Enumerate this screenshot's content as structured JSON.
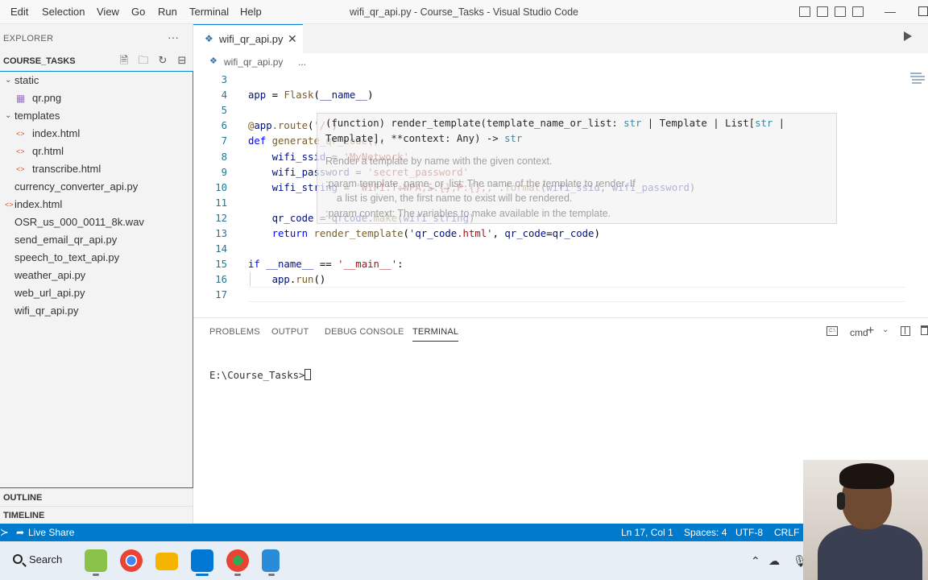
{
  "window": {
    "title": "wifi_qr_api.py - Course_Tasks - Visual Studio Code",
    "menu": [
      "Edit",
      "Selection",
      "View",
      "Go",
      "Run",
      "Terminal",
      "Help"
    ]
  },
  "sidebar": {
    "title": "EXPLORER",
    "more": "···",
    "folder": "COURSE_TASKS",
    "tree": [
      {
        "label": "static",
        "kind": "folder",
        "depth": 0
      },
      {
        "label": "qr.png",
        "kind": "image",
        "depth": 1
      },
      {
        "label": "templates",
        "kind": "folder",
        "depth": 0
      },
      {
        "label": "index.html",
        "kind": "html",
        "depth": 1
      },
      {
        "label": "qr.html",
        "kind": "html",
        "depth": 1
      },
      {
        "label": "transcribe.html",
        "kind": "html",
        "depth": 1
      },
      {
        "label": "currency_converter_api.py",
        "kind": "py",
        "depth": 0
      },
      {
        "label": "index.html",
        "kind": "html",
        "depth": 0
      },
      {
        "label": "OSR_us_000_0011_8k.wav",
        "kind": "wav",
        "depth": 0
      },
      {
        "label": "send_email_qr_api.py",
        "kind": "py",
        "depth": 0
      },
      {
        "label": "speech_to_text_api.py",
        "kind": "py",
        "depth": 0
      },
      {
        "label": "weather_api.py",
        "kind": "py",
        "depth": 0
      },
      {
        "label": "web_url_api.py",
        "kind": "py",
        "depth": 0
      },
      {
        "label": "wifi_qr_api.py",
        "kind": "py",
        "depth": 0
      }
    ],
    "outline": "OUTLINE",
    "timeline": "TIMELINE"
  },
  "editor": {
    "tab": "wifi_qr_api.py",
    "close": "✕",
    "breadcrumb_file": "wifi_qr_api.py",
    "breadcrumb_more": "...",
    "lines": [
      {
        "n": "3",
        "t": ""
      },
      {
        "n": "4",
        "t": "app = Flask(__name__)"
      },
      {
        "n": "5",
        "t": ""
      },
      {
        "n": "6",
        "t": "@app.route('/')"
      },
      {
        "n": "7",
        "t": "def generate_qr_code():"
      },
      {
        "n": "8",
        "t": "    wifi_ssid = 'MyNetwork'"
      },
      {
        "n": "9",
        "t": "    wifi_password = 'secret_password'"
      },
      {
        "n": "10",
        "t": "    wifi_string = 'WIFI:T:WPA;S:{};P:{};;'.format(wifi_ssid, wifi_password)"
      },
      {
        "n": "11",
        "t": ""
      },
      {
        "n": "12",
        "t": "    qr_code = qrcode.make(wifi_string)"
      },
      {
        "n": "13",
        "t": "    return render_template('qr_code.html', qr_code=qr_code)"
      },
      {
        "n": "14",
        "t": ""
      },
      {
        "n": "15",
        "t": "if __name__ == '__main__':"
      },
      {
        "n": "16",
        "t": "    app.run()"
      },
      {
        "n": "17",
        "t": ""
      }
    ],
    "hover": {
      "sig1_a": "(function) render_template(template_name_or_list: ",
      "sig1_b": "str",
      "sig1_c": " | Template | List[",
      "sig1_d": "str",
      "sig1_e": " |",
      "sig2_a": "Template], **context: Any) -> ",
      "sig2_b": "str",
      "doc1": "Render a template by name with the given context.",
      "doc2": ":param template_name_or_list: The name of the template to render. If",
      "doc3": "    a list is given, the first name to exist will be rendered.",
      "doc4": ":param context: The variables to make available in the template."
    }
  },
  "panel": {
    "tabs": [
      "PROBLEMS",
      "OUTPUT",
      "DEBUG CONSOLE",
      "TERMINAL"
    ],
    "terminal_name": "cmd",
    "prompt": "E:\\Course_Tasks>"
  },
  "statusbar": {
    "live_share": "Live Share",
    "position": "Ln 17, Col 1",
    "spaces": "Spaces: 4",
    "encoding": "UTF-8",
    "eol": "CRLF"
  },
  "taskbar": {
    "search": "Search"
  },
  "colors": {
    "accent": "#007acc",
    "sidebar_bg": "#f3f3f3",
    "keyword": "#0000ff",
    "string": "#a31515"
  }
}
